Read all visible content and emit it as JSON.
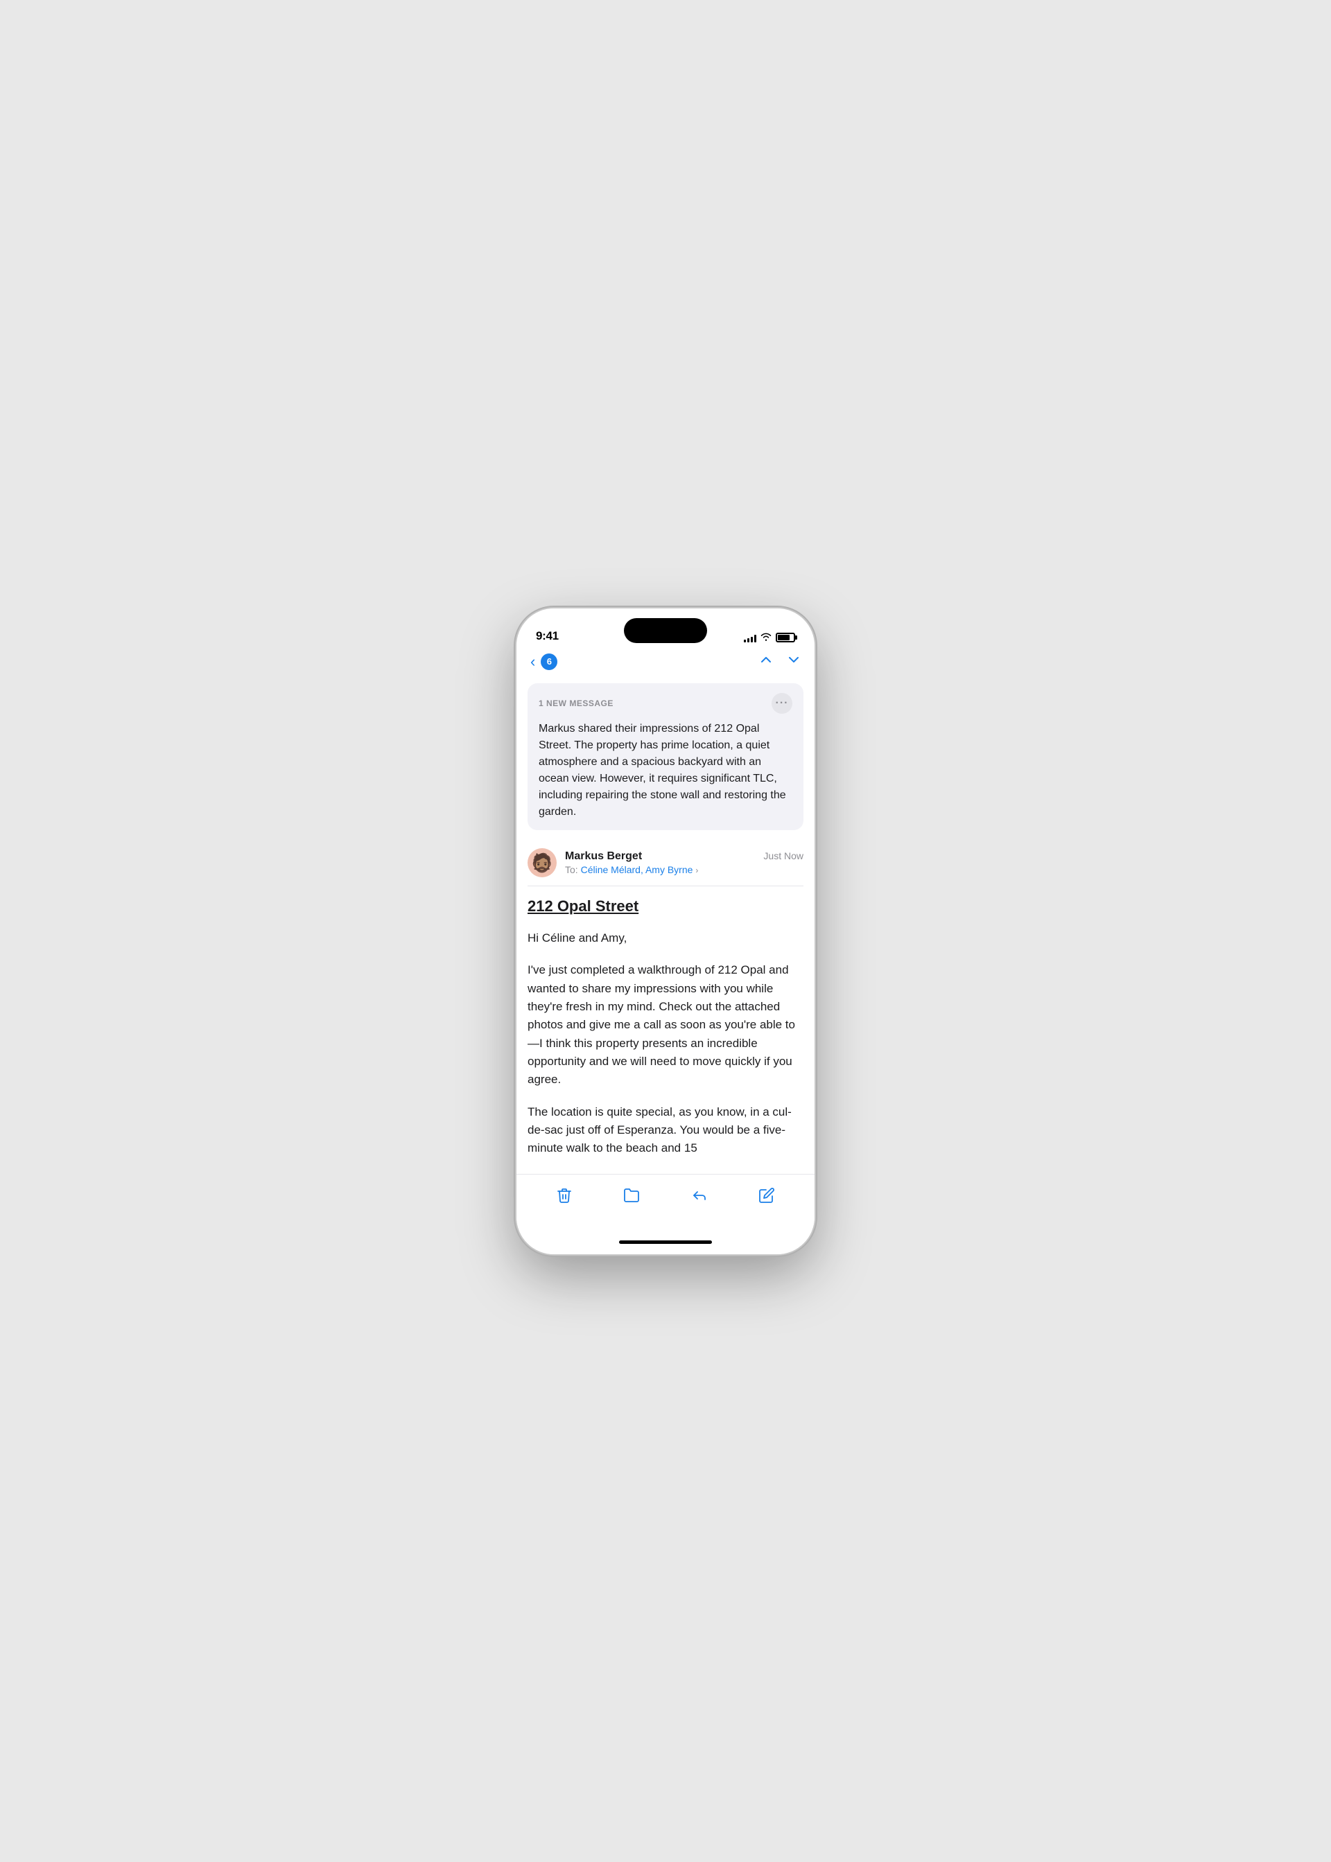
{
  "status_bar": {
    "time": "9:41",
    "signal_bars": [
      4,
      6,
      8,
      10,
      12
    ],
    "wifi": "wifi",
    "battery_level": 75
  },
  "nav": {
    "back_label": "‹",
    "badge_count": "6",
    "prev_label": "∧",
    "next_label": "∨"
  },
  "summary_card": {
    "new_message_label": "1 NEW MESSAGE",
    "more_button_label": "···",
    "summary_text": "Markus shared their impressions of 212 Opal Street. The property has prime location, a quiet atmosphere and a spacious backyard with an ocean view. However, it requires significant TLC, including repairing the stone wall and restoring the garden."
  },
  "email_header": {
    "sender_name": "Markus Berget",
    "time": "Just Now",
    "to_label": "To:",
    "recipients": "Céline Mélard, Amy Byrne",
    "recipients_chevron": "›"
  },
  "email_body": {
    "subject": "212 Opal Street",
    "greeting": "Hi Céline and Amy,",
    "paragraph1": "I've just completed a walkthrough of 212 Opal and wanted to share my impressions with you while they're fresh in my mind. Check out the attached photos and give me a call as soon as you're able to—I think this property presents an incredible opportunity and we will need to move quickly if you agree.",
    "paragraph2": "The location is quite special, as you know, in a cul-de-sac just off of Esperanza. You would be a five-minute walk to the beach and 15"
  },
  "toolbar": {
    "delete_label": "Delete",
    "folder_label": "Folder",
    "reply_label": "Reply",
    "compose_label": "Compose"
  }
}
